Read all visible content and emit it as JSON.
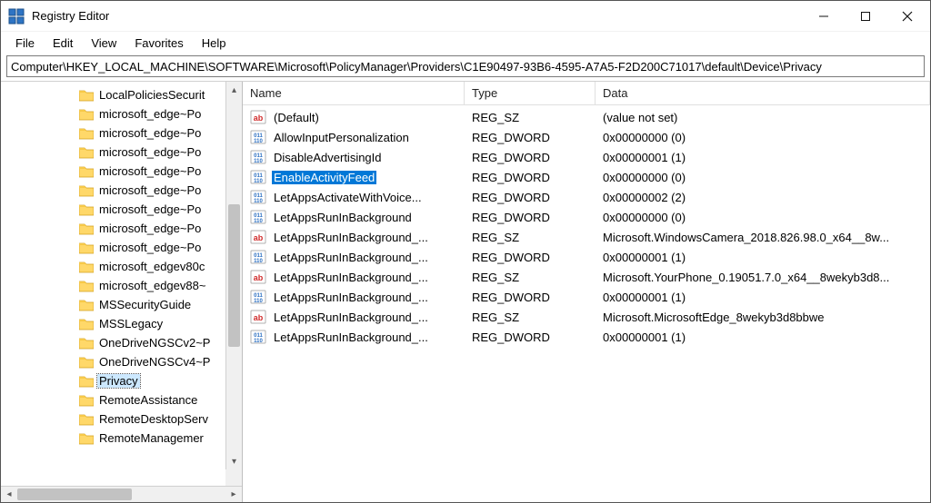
{
  "window": {
    "title": "Registry Editor"
  },
  "menu": {
    "items": [
      "File",
      "Edit",
      "View",
      "Favorites",
      "Help"
    ]
  },
  "address": {
    "path": "Computer\\HKEY_LOCAL_MACHINE\\SOFTWARE\\Microsoft\\PolicyManager\\Providers\\C1E90497-93B6-4595-A7A5-F2D200C71017\\default\\Device\\Privacy"
  },
  "tree": {
    "items": [
      {
        "label": "LocalPoliciesSecurit",
        "selected": false
      },
      {
        "label": "microsoft_edge~Po",
        "selected": false
      },
      {
        "label": "microsoft_edge~Po",
        "selected": false
      },
      {
        "label": "microsoft_edge~Po",
        "selected": false
      },
      {
        "label": "microsoft_edge~Po",
        "selected": false
      },
      {
        "label": "microsoft_edge~Po",
        "selected": false
      },
      {
        "label": "microsoft_edge~Po",
        "selected": false
      },
      {
        "label": "microsoft_edge~Po",
        "selected": false
      },
      {
        "label": "microsoft_edge~Po",
        "selected": false
      },
      {
        "label": "microsoft_edgev80c",
        "selected": false
      },
      {
        "label": "microsoft_edgev88~",
        "selected": false
      },
      {
        "label": "MSSecurityGuide",
        "selected": false
      },
      {
        "label": "MSSLegacy",
        "selected": false
      },
      {
        "label": "OneDriveNGSCv2~P",
        "selected": false
      },
      {
        "label": "OneDriveNGSCv4~P",
        "selected": false
      },
      {
        "label": "Privacy",
        "selected": true
      },
      {
        "label": "RemoteAssistance",
        "selected": false
      },
      {
        "label": "RemoteDesktopServ",
        "selected": false
      },
      {
        "label": "RemoteManagemer",
        "selected": false
      }
    ]
  },
  "list": {
    "columns": {
      "name": "Name",
      "type": "Type",
      "data": "Data"
    },
    "rows": [
      {
        "icon": "sz",
        "name": "(Default)",
        "type": "REG_SZ",
        "data": "(value not set)",
        "selected": false
      },
      {
        "icon": "dword",
        "name": "AllowInputPersonalization",
        "type": "REG_DWORD",
        "data": "0x00000000 (0)",
        "selected": false
      },
      {
        "icon": "dword",
        "name": "DisableAdvertisingId",
        "type": "REG_DWORD",
        "data": "0x00000001 (1)",
        "selected": false
      },
      {
        "icon": "dword",
        "name": "EnableActivityFeed",
        "type": "REG_DWORD",
        "data": "0x00000000 (0)",
        "selected": true
      },
      {
        "icon": "dword",
        "name": "LetAppsActivateWithVoice...",
        "type": "REG_DWORD",
        "data": "0x00000002 (2)",
        "selected": false
      },
      {
        "icon": "dword",
        "name": "LetAppsRunInBackground",
        "type": "REG_DWORD",
        "data": "0x00000000 (0)",
        "selected": false
      },
      {
        "icon": "sz",
        "name": "LetAppsRunInBackground_...",
        "type": "REG_SZ",
        "data": "Microsoft.WindowsCamera_2018.826.98.0_x64__8w...",
        "selected": false
      },
      {
        "icon": "dword",
        "name": "LetAppsRunInBackground_...",
        "type": "REG_DWORD",
        "data": "0x00000001 (1)",
        "selected": false
      },
      {
        "icon": "sz",
        "name": "LetAppsRunInBackground_...",
        "type": "REG_SZ",
        "data": "Microsoft.YourPhone_0.19051.7.0_x64__8wekyb3d8...",
        "selected": false
      },
      {
        "icon": "dword",
        "name": "LetAppsRunInBackground_...",
        "type": "REG_DWORD",
        "data": "0x00000001 (1)",
        "selected": false
      },
      {
        "icon": "sz",
        "name": "LetAppsRunInBackground_...",
        "type": "REG_SZ",
        "data": "Microsoft.MicrosoftEdge_8wekyb3d8bbwe",
        "selected": false
      },
      {
        "icon": "dword",
        "name": "LetAppsRunInBackground_...",
        "type": "REG_DWORD",
        "data": "0x00000001 (1)",
        "selected": false
      }
    ]
  }
}
